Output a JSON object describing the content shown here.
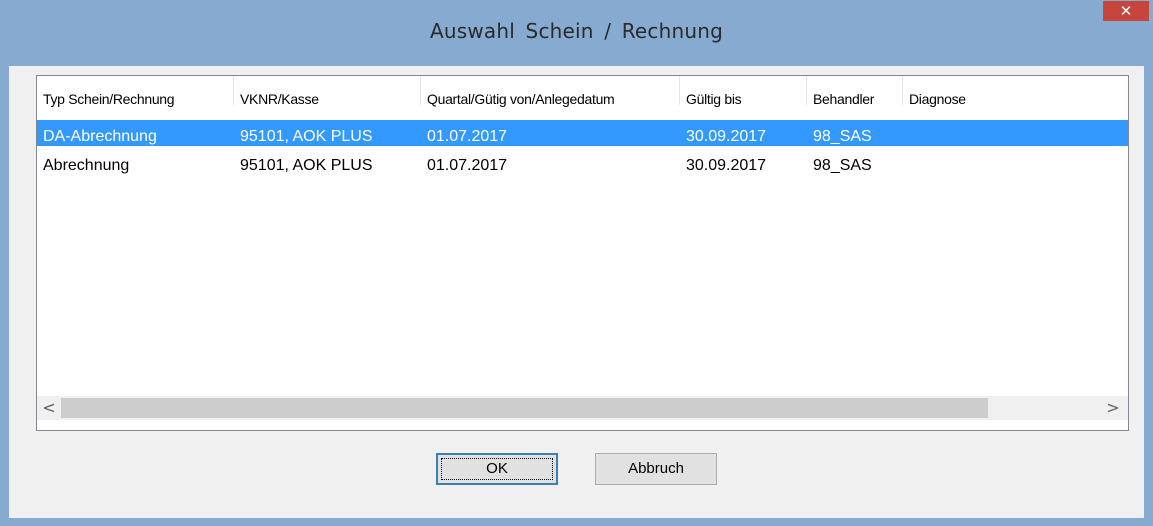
{
  "window": {
    "title": "Auswahl  Schein /  Rechnung",
    "close_glyph": "✕"
  },
  "list": {
    "columns": [
      "Typ Schein/Rechnung",
      "VKNR/Kasse",
      "Quartal/Gütig von/Anlegedatum",
      "Gültig bis",
      "Behandler",
      "Diagnose"
    ],
    "rows": [
      {
        "typ": "DA-Abrechnung",
        "kasse": "95101, AOK PLUS",
        "von": "01.07.2017",
        "bis": "30.09.2017",
        "behandler": "98_SAS",
        "diagnose": "",
        "selected": true
      },
      {
        "typ": "Abrechnung",
        "kasse": "95101, AOK PLUS",
        "von": "01.07.2017",
        "bis": "30.09.2017",
        "behandler": "98_SAS",
        "diagnose": "",
        "selected": false
      }
    ],
    "scroll_left_glyph": "<",
    "scroll_right_glyph": ">"
  },
  "buttons": {
    "ok_label": "OK",
    "cancel_label": "Abbruch"
  },
  "colors": {
    "titlebar": "#87abd0",
    "selection": "#3399ff",
    "close": "#c6463d"
  }
}
